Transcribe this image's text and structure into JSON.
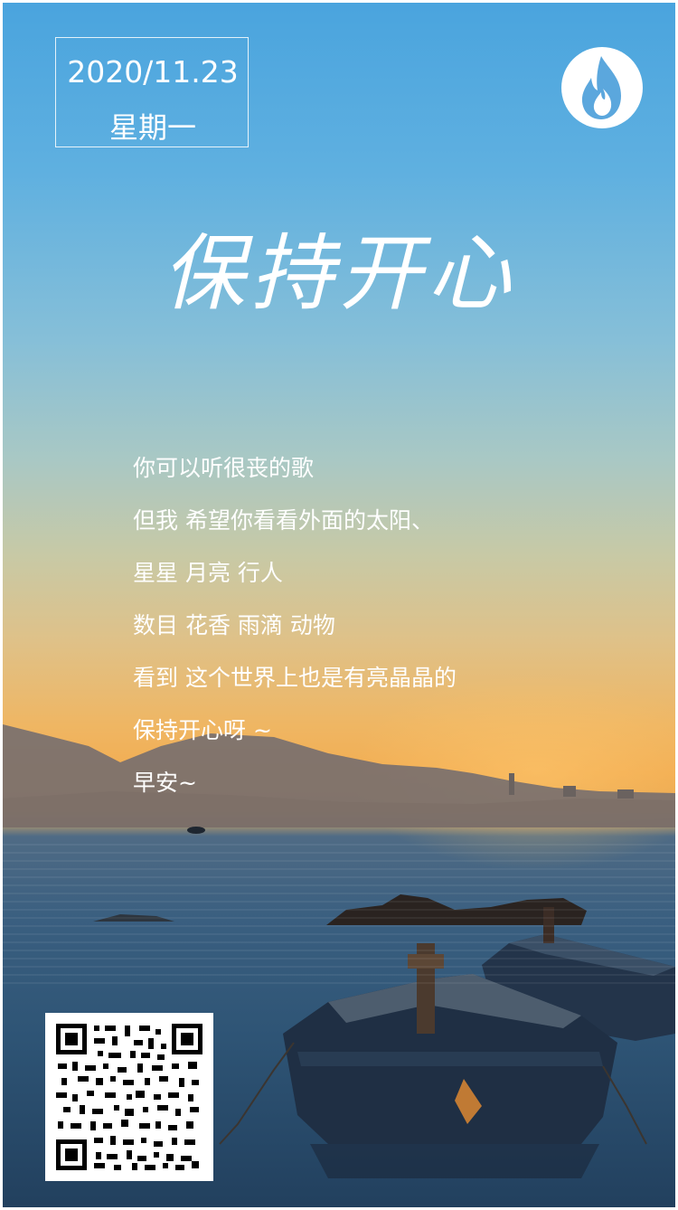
{
  "poster": {
    "date": "2020/11.23",
    "weekday": "星期一",
    "headline": "保持开心",
    "poem": [
      "你可以听很丧的歌",
      "但我 希望你看看外面的太阳、",
      "星星 月亮 行人",
      "数目 花香 雨滴 动物",
      "看到 这个世界上也是有亮晶晶的",
      "保持开心呀 ~",
      "早安~"
    ]
  },
  "icons": {
    "logo": "flame-icon",
    "qr": "qr-code-icon"
  },
  "colors": {
    "sky_top": "#4aa4de",
    "sunset_orange": "#f2ad52",
    "sea": "#2e5475",
    "logo_flame": "#5ba7dd"
  }
}
